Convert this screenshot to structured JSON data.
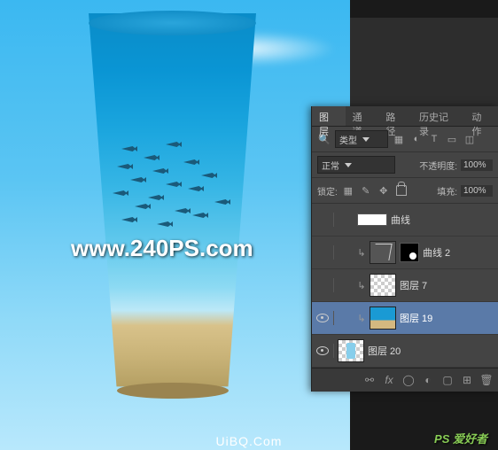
{
  "watermark": "www.240PS.com",
  "panel": {
    "tabs": [
      "图层",
      "通道",
      "路径",
      "历史记录",
      "动作"
    ],
    "active_tab": 0,
    "filter_label": "类型",
    "blend_mode": "正常",
    "opacity_label": "不透明度:",
    "opacity_value": "100%",
    "lock_label": "锁定:",
    "fill_label": "填充:",
    "fill_value": "100%"
  },
  "layers": [
    {
      "visible": false,
      "indent": true,
      "type": "adj",
      "mask": "wide",
      "name": "曲线",
      "selected": false
    },
    {
      "visible": false,
      "indent": true,
      "type": "curves",
      "mask": true,
      "name": "曲线 2",
      "selected": false
    },
    {
      "visible": false,
      "indent": true,
      "type": "img",
      "mask": false,
      "name": "图层 7",
      "selected": false
    },
    {
      "visible": true,
      "indent": true,
      "type": "img2",
      "mask": false,
      "name": "图层 19",
      "selected": true
    },
    {
      "visible": true,
      "indent": false,
      "type": "img3",
      "mask": false,
      "name": "图层 20",
      "selected": false
    }
  ],
  "footer": {
    "logo": "PS 爱好者",
    "url": "UiBQ.Com"
  }
}
